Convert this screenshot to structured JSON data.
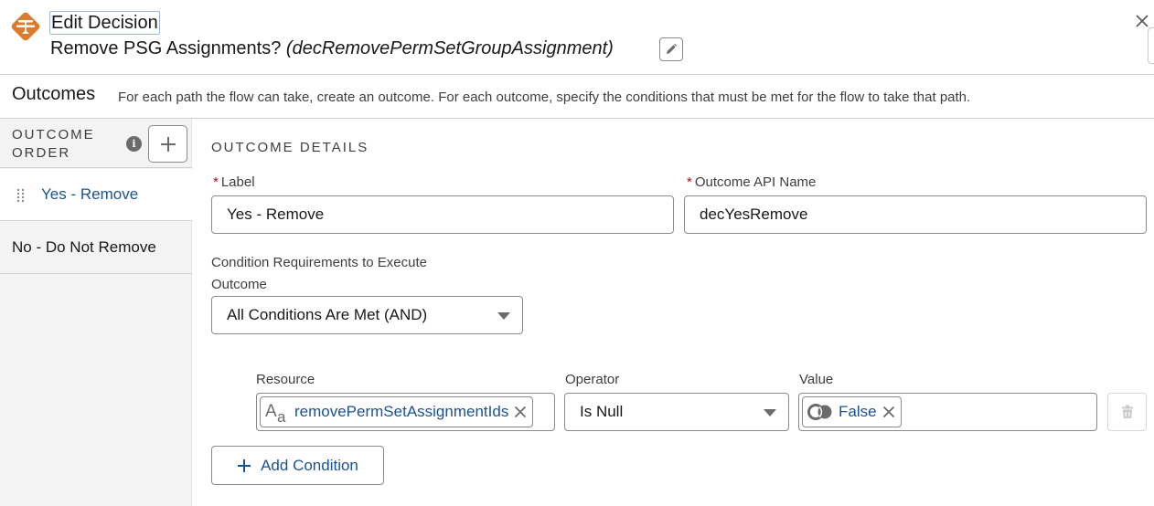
{
  "header": {
    "title": "Edit Decision",
    "element_label": "Remove PSG Assignments?",
    "element_api_name": "(decRemovePermSetGroupAssignment)",
    "icon": "decision-icon",
    "accent_color": "#dd7a2b",
    "edit_icon": "pencil-icon",
    "close_icon": "close-icon"
  },
  "outcomes_bar": {
    "title": "Outcomes",
    "description": "For each path the flow can take, create an outcome. For each outcome, specify the conditions that must be met for the flow to take that path."
  },
  "sidebar": {
    "heading": "OUTCOME ORDER",
    "info_icon": "info-icon",
    "add_icon": "plus-icon",
    "items": [
      {
        "label": "Yes - Remove",
        "selected": true
      },
      {
        "label": "No - Do Not Remove",
        "selected": false
      }
    ]
  },
  "details": {
    "section_title": "OUTCOME DETAILS",
    "label_field": {
      "label": "Label",
      "required": "*",
      "value": "Yes - Remove"
    },
    "api_name_field": {
      "label": "Outcome API Name",
      "required": "*",
      "value": "decYesRemove"
    },
    "condition_requirements": {
      "label": "Condition Requirements to Execute Outcome",
      "selected": "All Conditions Are Met (AND)"
    },
    "conditions": [
      {
        "resource_label": "Resource",
        "resource_value": "removePermSetAssignmentIds",
        "resource_icon": "text-variable-icon",
        "operator_label": "Operator",
        "operator_value": "Is Null",
        "value_label": "Value",
        "value_value": "False",
        "value_icon": "boolean-icon"
      }
    ],
    "add_condition_label": "Add Condition"
  }
}
